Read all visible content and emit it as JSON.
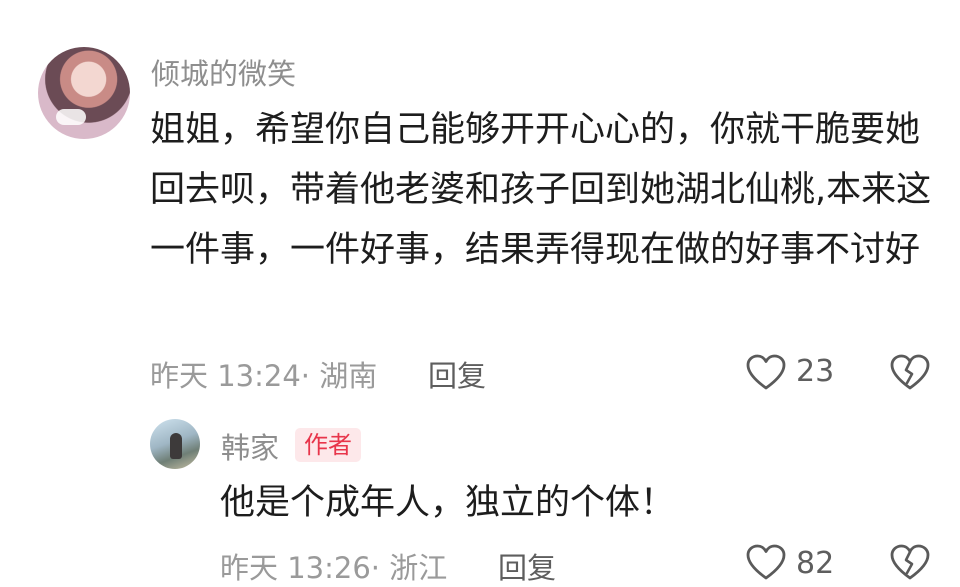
{
  "comment": {
    "username": "倾城的微笑",
    "text": "姐姐，希望你自己能够开开心心的，你就干脆要她回去呗，带着他老婆和孩子回到她湖北仙桃,本来这一件事，一件好事，结果弄得现在做的好事不讨好",
    "meta": "昨天 13:24· 湖南",
    "reply_label": "回复",
    "like_count": "23",
    "avatar_icon": "user-avatar",
    "like_icon": "heart-outline-icon",
    "dislike_icon": "broken-heart-icon"
  },
  "reply": {
    "username": "韩家",
    "badge": "作者",
    "text": "他是个成年人，独立的个体！",
    "meta": "昨天 13:26· 浙江",
    "reply_label": "回复",
    "like_count": "82",
    "avatar_icon": "user-avatar",
    "like_icon": "heart-outline-icon",
    "dislike_icon": "broken-heart-icon"
  },
  "colors": {
    "badge_text": "#e8354b",
    "badge_bg": "#fde8ea",
    "username": "#8e8e8e",
    "meta": "#9a9a9a"
  }
}
